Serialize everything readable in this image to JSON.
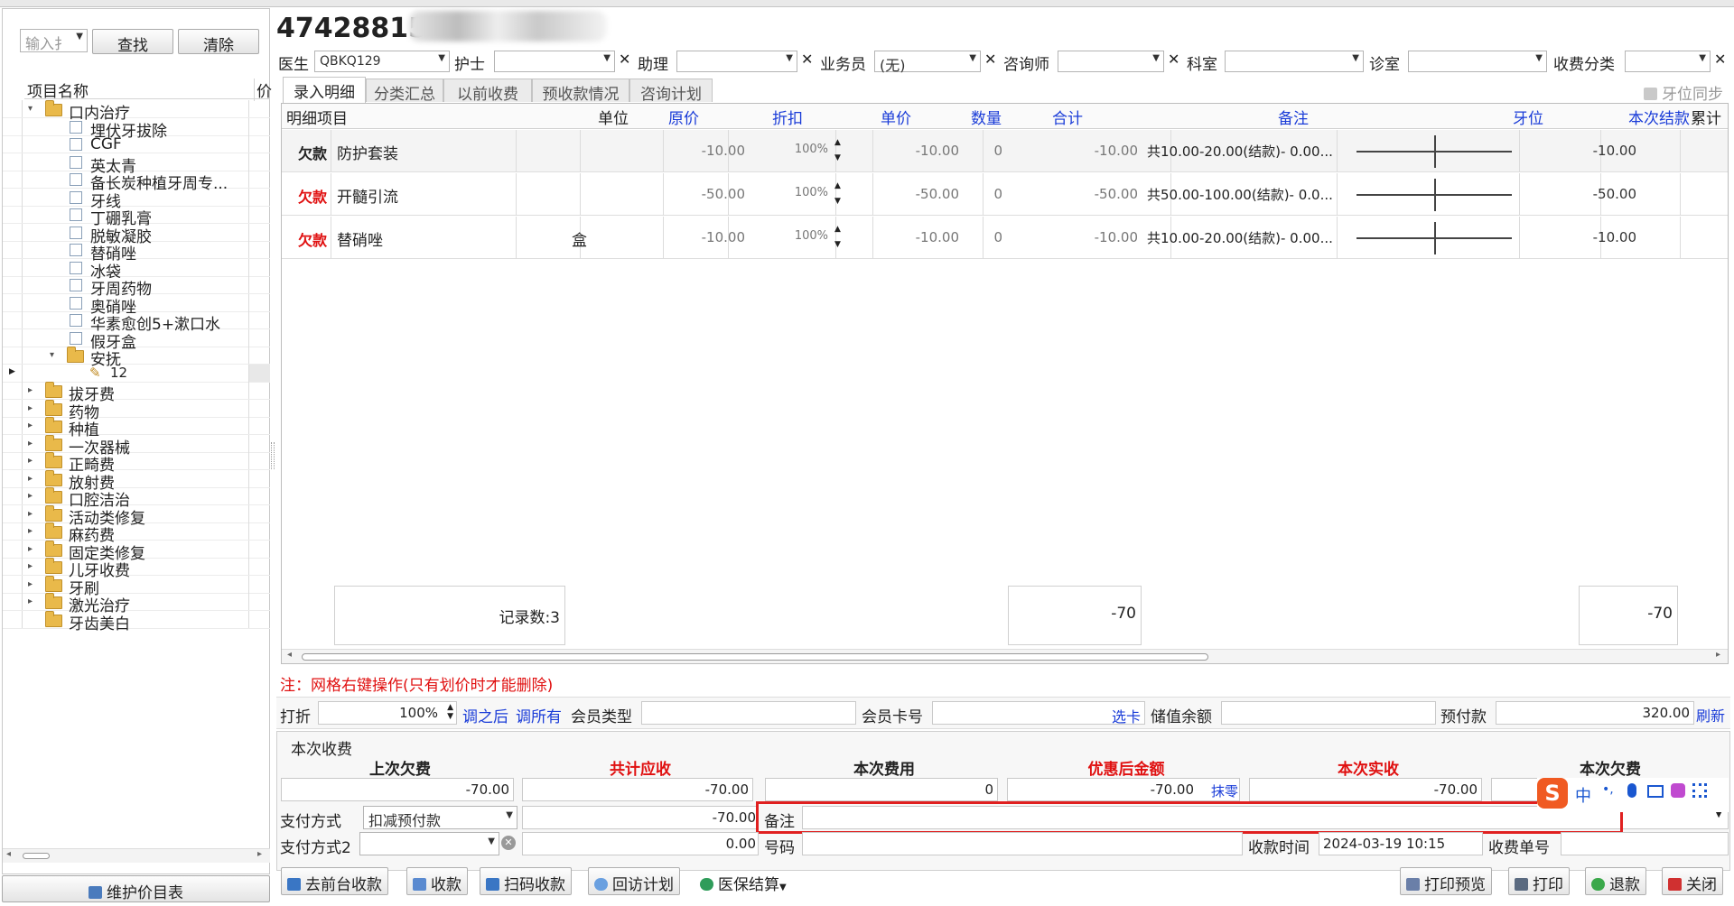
{
  "left": {
    "search_placeholder": "输入扌",
    "find_label": "查找",
    "clear_label": "清除",
    "col_name": "项目名称",
    "col_price": "价",
    "tree": [
      {
        "label": "口内治疗",
        "kind": "folder",
        "level": 0,
        "expanded": true
      },
      {
        "label": "埋伏牙拔除",
        "kind": "item",
        "level": 2
      },
      {
        "label": "CGF",
        "kind": "item",
        "level": 2
      },
      {
        "label": "英太青",
        "kind": "item",
        "level": 2
      },
      {
        "label": "备长炭种植牙周专...",
        "kind": "item",
        "level": 2
      },
      {
        "label": "牙线",
        "kind": "item",
        "level": 2
      },
      {
        "label": "丁硼乳膏",
        "kind": "item",
        "level": 2
      },
      {
        "label": "脱敏凝胶",
        "kind": "item",
        "level": 2
      },
      {
        "label": "替硝唑",
        "kind": "item",
        "level": 2
      },
      {
        "label": "冰袋",
        "kind": "item",
        "level": 2
      },
      {
        "label": "牙周药物",
        "kind": "item",
        "level": 2
      },
      {
        "label": "奥硝唑",
        "kind": "item",
        "level": 2
      },
      {
        "label": "华素愈创5+漱口水",
        "kind": "item",
        "level": 2
      },
      {
        "label": "假牙盒",
        "kind": "item",
        "level": 2
      },
      {
        "label": "安抚",
        "kind": "folder",
        "level": 1,
        "expanded": true
      },
      {
        "label": "12",
        "kind": "edit",
        "level": 3
      },
      {
        "label": "拔牙费",
        "kind": "folder",
        "level": 0
      },
      {
        "label": "药物",
        "kind": "folder",
        "level": 0
      },
      {
        "label": "种植",
        "kind": "folder",
        "level": 0
      },
      {
        "label": "一次器械",
        "kind": "folder",
        "level": 0
      },
      {
        "label": "正畸费",
        "kind": "folder",
        "level": 0
      },
      {
        "label": "放射费",
        "kind": "folder",
        "level": 0
      },
      {
        "label": "口腔洁治",
        "kind": "folder",
        "level": 0
      },
      {
        "label": "活动类修复",
        "kind": "folder",
        "level": 0
      },
      {
        "label": "麻药费",
        "kind": "folder",
        "level": 0
      },
      {
        "label": "固定类修复",
        "kind": "folder",
        "level": 0
      },
      {
        "label": "儿牙收费",
        "kind": "folder",
        "level": 0
      },
      {
        "label": "牙刷",
        "kind": "folder",
        "level": 0
      },
      {
        "label": "激光治疗",
        "kind": "folder",
        "level": 0
      },
      {
        "label": "牙齿美白",
        "kind": "folder",
        "level": 0,
        "leaf": true
      }
    ],
    "maintain_label": "维护价目表"
  },
  "patient_id": "47428815",
  "header_fields": {
    "doctor_label": "医生",
    "doctor_value": "QBKQ129",
    "nurse_label": "护士",
    "assistant_label": "助理",
    "sales_label": "业务员",
    "sales_value": "(无)",
    "consultant_label": "咨询师",
    "dept_label": "科室",
    "clinic_label": "诊室",
    "category_label": "收费分类"
  },
  "tabs": [
    "录入明细",
    "分类汇总",
    "以前收费",
    "预收款情况",
    "咨询计划"
  ],
  "tooth_sync_label": "牙位同步",
  "table": {
    "headers": [
      "明细项目",
      "单位",
      "原价",
      "折扣",
      "单价",
      "数量",
      "合计",
      "备注",
      "牙位",
      "本次结款",
      "累计"
    ],
    "rows": [
      {
        "tag": "欠款",
        "item": "防护套装",
        "unit": "",
        "orig": "-10.00",
        "discount": "100%",
        "price": "-10.00",
        "qty": "0",
        "total": "-10.00",
        "note": "共10.00-20.00(结款)- 0.00...",
        "this_pay": "-10.00"
      },
      {
        "tag": "欠款",
        "item": "开髓引流",
        "unit": "",
        "orig": "-50.00",
        "discount": "100%",
        "price": "-50.00",
        "qty": "0",
        "total": "-50.00",
        "note": "共50.00-100.00(结款)- 0.0...",
        "this_pay": "-50.00"
      },
      {
        "tag": "欠款",
        "item": "替硝唑",
        "unit": "盒",
        "orig": "-10.00",
        "discount": "100%",
        "price": "-10.00",
        "qty": "0",
        "total": "-10.00",
        "note": "共10.00-20.00(结款)- 0.00...",
        "this_pay": "-10.00"
      }
    ],
    "footer": {
      "record_count": "记录数:3",
      "sum_total": "-70",
      "sum_pay": "-70"
    }
  },
  "note_text": "注：网格右键操作(只有划价时才能删除)",
  "discount_row": {
    "label": "打折",
    "value": "100%",
    "adjust_after": "调之后",
    "adjust_all": "调所有",
    "member_type_label": "会员类型",
    "member_card_label": "会员卡号",
    "select_card": "选卡",
    "balance_label": "储值余额",
    "prepay_label": "预付款",
    "prepay_value": "320.00",
    "refresh": "刷新"
  },
  "charge": {
    "section_title": "本次收费",
    "heads": [
      "上次欠费",
      "共计应收",
      "本次费用",
      "优惠后金额",
      "本次实收",
      "本次欠费"
    ],
    "values": [
      "-70.00",
      "-70.00",
      "0",
      "-70.00",
      "-70.00",
      ""
    ],
    "round_label": "抹零",
    "pay_method_label": "支付方式",
    "pay_method_value": "扣减预付款",
    "pay_amount": "-70.00",
    "remark_label": "备注",
    "pay_method2_label": "支付方式2",
    "pay_amount2": "0.00",
    "number_label": "号码",
    "time_label": "收款时间",
    "time_value": "2024-03-19 10:15",
    "receipt_label": "收费单号"
  },
  "buttons": {
    "front_desk": "去前台收款",
    "collect": "收款",
    "scan": "扫码收款",
    "visit_plan": "回访计划",
    "insurance": "医保结算",
    "print_preview": "打印预览",
    "print": "打印",
    "refund": "退款",
    "close": "关闭"
  },
  "ime": {
    "zh": "中",
    "dot": "•,"
  },
  "colors": {
    "red": "#e01010",
    "blue": "#1a3cd8",
    "header_blue": "#1a3cd8",
    "highlight_box": "#e02020"
  }
}
